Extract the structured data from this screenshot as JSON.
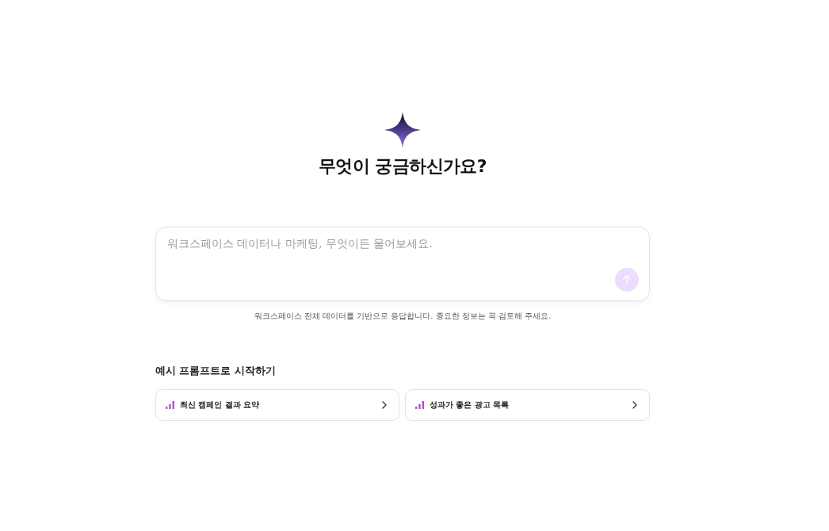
{
  "hero": {
    "title": "무엇이 궁금하신가요?"
  },
  "prompt_box": {
    "placeholder": "워크스페이스 데이터나 마케팅, 무엇이든 물어보세요.",
    "send_disabled": true
  },
  "disclaimer": "워크스페이스 전체 데이터를 기반으로 응답합니다. 중요한 정보는 꼭 검토해 주세요.",
  "examples": {
    "title": "예시 프롬프트로 시작하기",
    "items": [
      {
        "label": "최신 캠페인 결과 요약"
      },
      {
        "label": "성과가 좋은 광고 목록"
      }
    ]
  }
}
